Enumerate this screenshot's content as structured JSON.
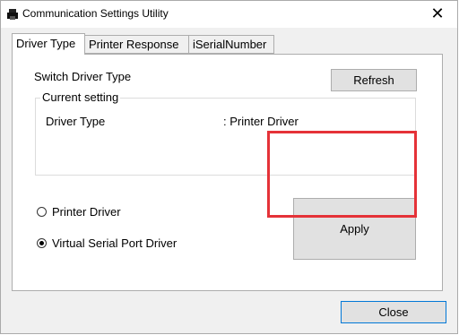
{
  "window": {
    "title": "Communication Settings Utility"
  },
  "tabs": [
    {
      "label": "Driver Type"
    },
    {
      "label": "Printer Response"
    },
    {
      "label": "iSerialNumber"
    }
  ],
  "panel": {
    "switch_label": "Switch Driver Type",
    "refresh_label": "Refresh",
    "group_title": "Current setting",
    "driver_type_label": "Driver Type",
    "driver_type_value": ": Printer Driver",
    "radio_printer_label": "Printer Driver",
    "radio_virtual_label": "Virtual Serial Port Driver",
    "apply_label": "Apply"
  },
  "footer": {
    "close_label": "Close"
  },
  "colors": {
    "highlight": "#e53238",
    "close_border": "#0078d7"
  },
  "icons": {
    "app": "printer-icon",
    "close": "close-x-icon"
  }
}
